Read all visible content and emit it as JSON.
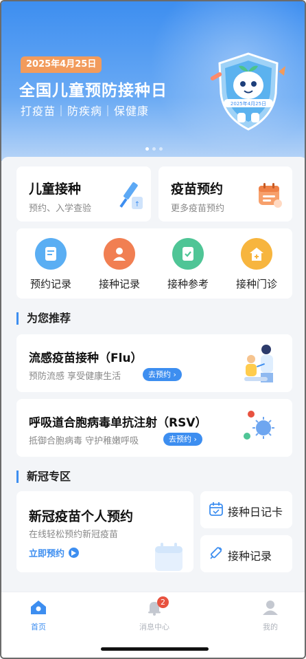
{
  "banner": {
    "date": "2025年4月25日",
    "title": "全国儿童预防接种日",
    "subtitle": "打疫苗｜防疾病｜保健康",
    "mascot_date": "2025年4月25日"
  },
  "quick": {
    "child": {
      "title": "儿童接种",
      "subtitle": "预约、入学查验"
    },
    "vaccine": {
      "title": "疫苗预约",
      "subtitle": "更多疫苗预约"
    }
  },
  "grid": [
    {
      "label": "预约记录",
      "icon": "document-icon"
    },
    {
      "label": "接种记录",
      "icon": "person-icon"
    },
    {
      "label": "接种参考",
      "icon": "checklist-icon"
    },
    {
      "label": "接种门诊",
      "icon": "clinic-icon"
    }
  ],
  "recommend": {
    "title": "为您推荐",
    "items": [
      {
        "title": "流感疫苗接种（Flu）",
        "subtitle": "预防流感 享受健康生活",
        "button": "去预约 ›"
      },
      {
        "title": "呼吸道合胞病毒单抗注射（RSV）",
        "subtitle": "抵御合胞病毒 守护稚嫩呼吸",
        "button": "去预约 ›"
      }
    ]
  },
  "covid": {
    "title": "新冠专区",
    "main": {
      "title": "新冠疫苗个人预约",
      "subtitle": "在线轻松预约新冠疫苗",
      "link": "立即预约"
    },
    "diary": "接种日记卡",
    "record": "接种记录"
  },
  "tabbar": {
    "home": "首页",
    "messages": "消息中心",
    "messages_badge": "2",
    "mine": "我的"
  },
  "colors": {
    "accent": "#3d8ef0",
    "badge": "#e8523f",
    "date_pill": "#f29b5c"
  }
}
